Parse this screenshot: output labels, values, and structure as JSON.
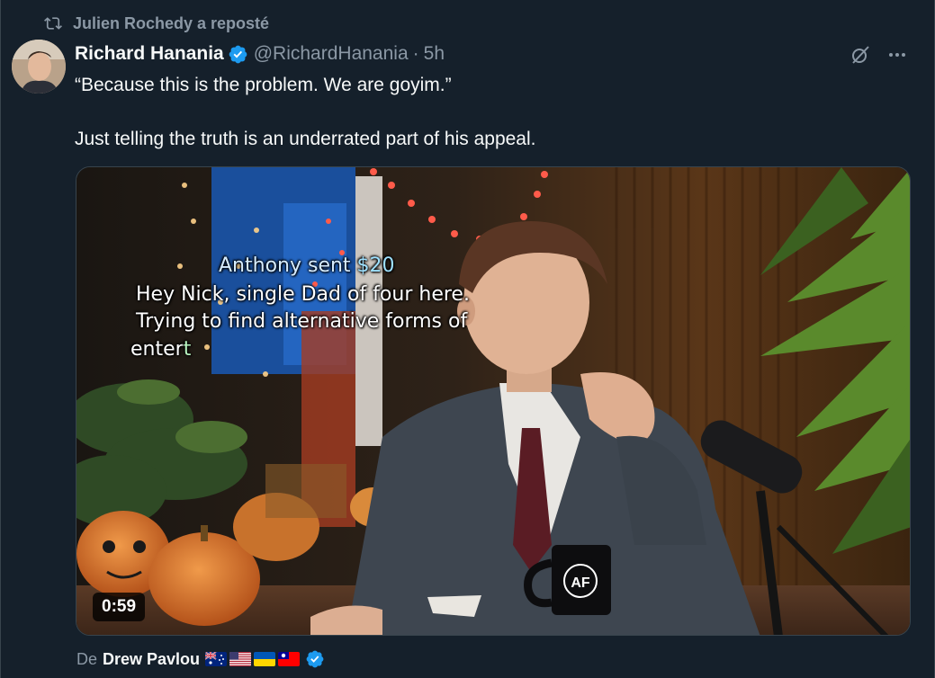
{
  "social_context": {
    "text": "Julien Rochedy a reposté",
    "icon": "repost-icon"
  },
  "author": {
    "name": "Richard Hanania",
    "handle": "@RichardHanania",
    "separator": "·",
    "time": "5h",
    "verified": true,
    "verified_color": "#1d9bf0"
  },
  "actions": {
    "grok_icon": "grok-icon",
    "more_icon": "more-icon",
    "more_label": "···"
  },
  "tweet": {
    "line1": "“Because this is the problem. We are goyim.”",
    "line2": "Just telling the truth is an underrated part of his appeal."
  },
  "media": {
    "type": "video",
    "duration": "0:59",
    "overlay": {
      "sender": "Anthony sent ",
      "amount": "$20",
      "line2": "Hey Nick, single Dad of four here.",
      "line3": "Trying to find alternative forms of",
      "line4_a": "enter",
      "line4_b": "t",
      "mug_text": "AF"
    }
  },
  "attribution": {
    "prefix": "De",
    "name": "Drew Pavlou",
    "flags": [
      "australia-flag",
      "usa-flag",
      "ukraine-flag",
      "taiwan-flag"
    ],
    "verified": true
  },
  "colors": {
    "background": "#15202b",
    "text_primary": "#f7f9f9",
    "text_secondary": "#8b98a5",
    "accent": "#1d9bf0",
    "border": "#38444d"
  }
}
